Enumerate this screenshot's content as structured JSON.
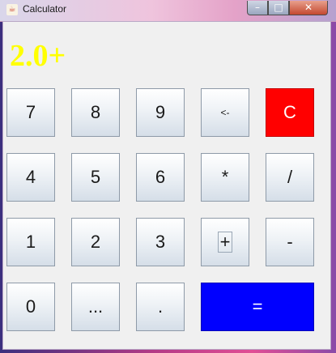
{
  "window": {
    "title": "Calculator",
    "controls": {
      "minimize": "–",
      "maximize": "□",
      "close": "✕"
    }
  },
  "display": {
    "value": "2.0+",
    "color": "#ffff00"
  },
  "keys": {
    "row1": [
      "7",
      "8",
      "9",
      "<-",
      "C"
    ],
    "row2": [
      "4",
      "5",
      "6",
      "*",
      "/"
    ],
    "row3": [
      "1",
      "2",
      "3",
      "+",
      "-"
    ],
    "row4": [
      "0",
      "...",
      ".",
      "="
    ]
  },
  "colors": {
    "clear": "#ff0000",
    "equals": "#0000ff"
  }
}
